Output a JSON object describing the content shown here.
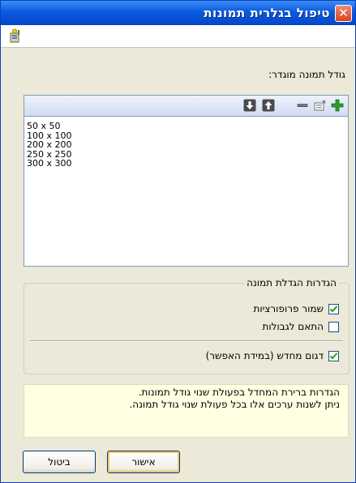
{
  "window": {
    "title": "טיפול בגלרית תמונות",
    "close_symbol": "✕"
  },
  "toolstrip": {
    "icon": "wizard-icon"
  },
  "size_section": {
    "label": "גודל תמונה מוגדר:",
    "toolbar_icons": [
      "add-icon",
      "edit-icon",
      "remove-icon",
      "move-up-icon",
      "move-down-icon"
    ],
    "sizes": [
      "50 x 50",
      "100 x 100",
      "200 x 200",
      "250 x 250",
      "300 x 300"
    ]
  },
  "enlarge_group": {
    "legend": "הגדרות הגדלת תמונה",
    "keep_proportions": {
      "label": "שמור פרופורציות",
      "checked": true
    },
    "fit_to_bounds": {
      "label": "התאם לגבולות",
      "checked": false
    },
    "resample": {
      "label": "דגום מחדש (במידת האפשר)",
      "checked": true
    }
  },
  "info": {
    "line1": "הגדרות ברירת המחדל בפעולת שנוי גודל תמונות.",
    "line2": "ניתן לשנות ערכים אלו בכל פעולת שנוי גודל תמונה."
  },
  "buttons": {
    "ok": "אישור",
    "cancel": "ביטול"
  },
  "colors": {
    "titlebar": "#0a5ae0",
    "info_bg": "#ffffe1",
    "dialog_bg": "#ece9d8",
    "add_icon": "#2e9a2e",
    "checkmark": "#21a121"
  }
}
